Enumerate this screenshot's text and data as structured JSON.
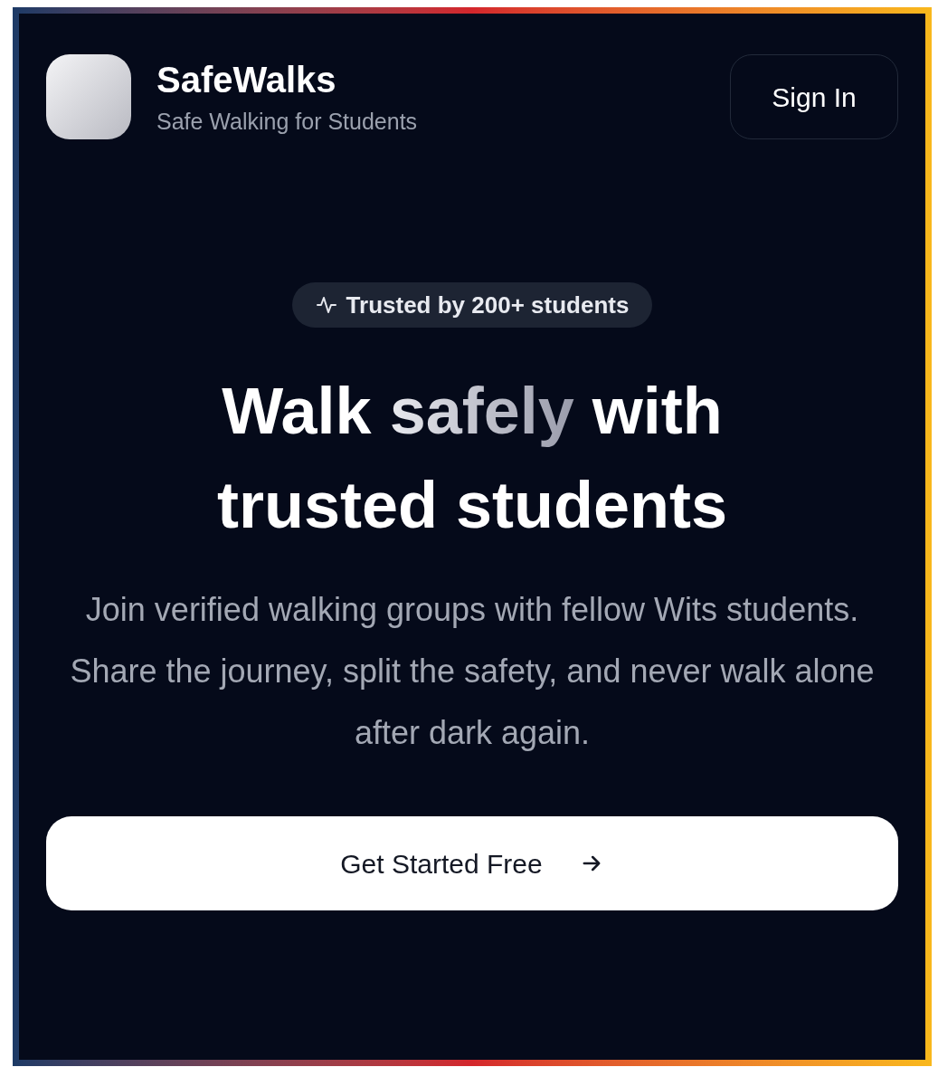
{
  "header": {
    "app_name": "SafeWalks",
    "tagline": "Safe Walking for Students",
    "sign_in": "Sign In"
  },
  "badge": {
    "text": "Trusted by 200+ students"
  },
  "headline": {
    "before": "Walk",
    "highlight": "safely",
    "after": "with trusted students"
  },
  "description": "Join verified walking groups with fellow Wits students. Share the journey, split the safety, and never walk alone after dark again.",
  "cta": {
    "label": "Get Started Free"
  }
}
